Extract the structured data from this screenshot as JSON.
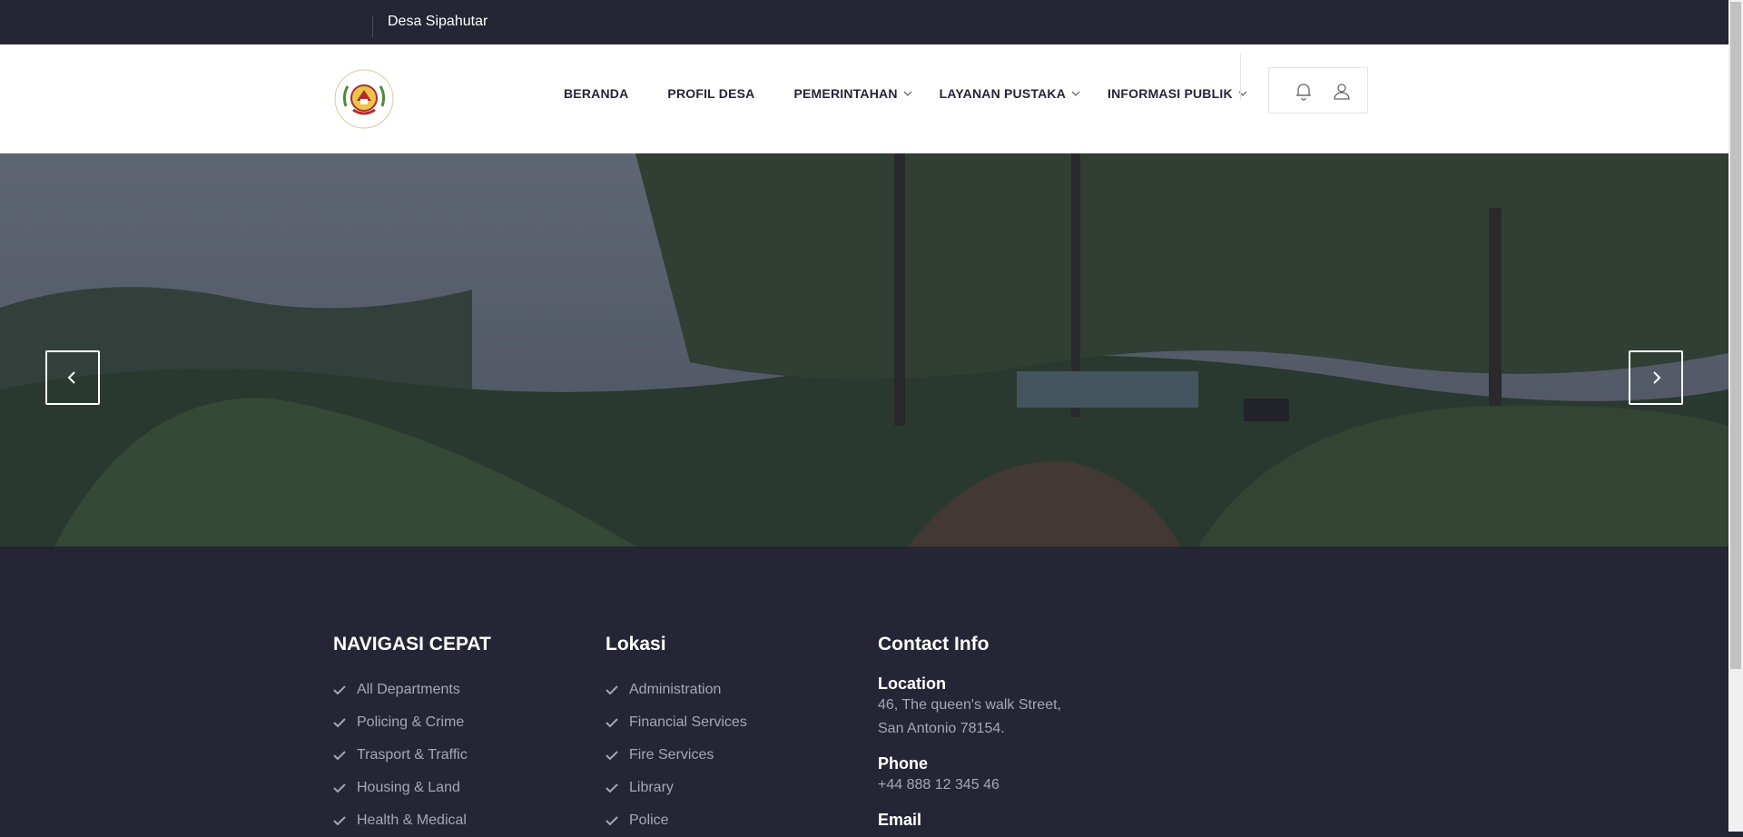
{
  "topbar": {
    "village_name": "Desa Sipahutar"
  },
  "header": {
    "logo_alt": "Sistem Informasi Desa Sipahutar logo",
    "nav": [
      {
        "label": "BERANDA",
        "has_submenu": false
      },
      {
        "label": "PROFIL DESA",
        "has_submenu": false
      },
      {
        "label": "PEMERINTAHAN",
        "has_submenu": true
      },
      {
        "label": "LAYANAN PUSTAKA",
        "has_submenu": true
      },
      {
        "label": "INFORMASI PUBLIK",
        "has_submenu": true
      }
    ],
    "icons": [
      "bell-icon",
      "user-icon"
    ]
  },
  "hero": {
    "prev_icon": "chevron-left-icon",
    "next_icon": "chevron-right-icon"
  },
  "footer": {
    "quick_nav": {
      "title": "NAVIGASI CEPAT",
      "items": [
        "All Departments",
        "Policing & Crime",
        "Trasport & Traffic",
        "Housing & Land",
        "Health & Medical"
      ]
    },
    "location": {
      "title": "Lokasi",
      "items": [
        "Administration",
        "Financial Services",
        "Fire Services",
        "Library",
        "Police"
      ]
    },
    "contact": {
      "title": "Contact Info",
      "location_label": "Location",
      "address_line1": "46, The queen's walk Street,",
      "address_line2": "San Antonio 78154.",
      "phone_label": "Phone",
      "phone": "+44 888 12 345 46",
      "email_label": "Email"
    }
  },
  "colors": {
    "dark": "#252536",
    "muted_text": "#a5a7b5",
    "white": "#ffffff"
  }
}
